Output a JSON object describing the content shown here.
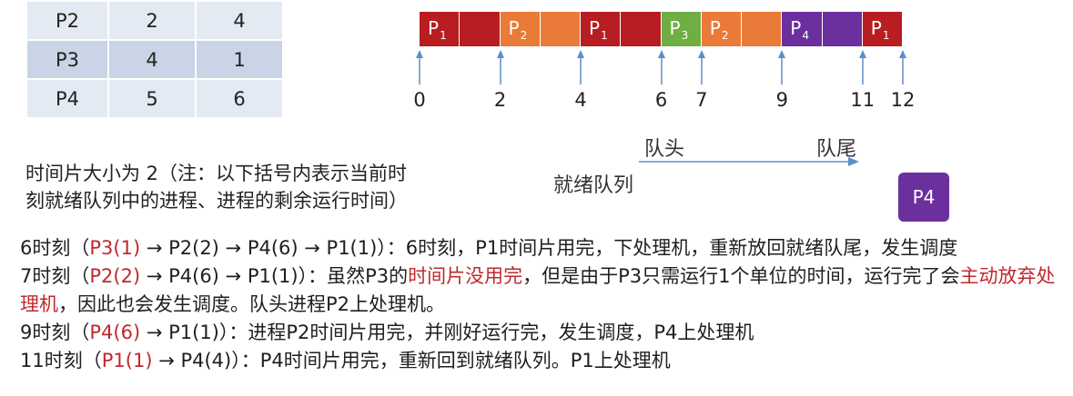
{
  "table": {
    "rows": [
      [
        "P2",
        "2",
        "4"
      ],
      [
        "P3",
        "4",
        "1"
      ],
      [
        "P4",
        "5",
        "6"
      ]
    ]
  },
  "gantt": {
    "segments": [
      {
        "label": "P",
        "sub": "1",
        "color": "#b81d22"
      },
      {
        "label": "",
        "sub": "",
        "color": "#b81d22"
      },
      {
        "label": "P",
        "sub": "2",
        "color": "#ea7a37"
      },
      {
        "label": "",
        "sub": "",
        "color": "#ea7a37"
      },
      {
        "label": "P",
        "sub": "1",
        "color": "#b81d22"
      },
      {
        "label": "",
        "sub": "",
        "color": "#b81d22"
      },
      {
        "label": "P",
        "sub": "3",
        "color": "#6fae43"
      },
      {
        "label": "P",
        "sub": "2",
        "color": "#ea7a37"
      },
      {
        "label": "",
        "sub": "",
        "color": "#ea7a37"
      },
      {
        "label": "P",
        "sub": "4",
        "color": "#6c2f9e"
      },
      {
        "label": "",
        "sub": "",
        "color": "#6c2f9e"
      },
      {
        "label": "P",
        "sub": "1",
        "color": "#b81d22"
      }
    ],
    "times": [
      "0",
      "2",
      "4",
      "6",
      "7",
      "9",
      "11",
      "12"
    ]
  },
  "queue": {
    "head": "队头",
    "tail": "队尾",
    "label": "就绪队列",
    "item": "P4"
  },
  "note": {
    "line1": "时间片大小为 2（注：以下括号内表示当前时",
    "line2": "刻就绪队列中的进程、进程的剩余运行时间）"
  },
  "lines": {
    "l1a": "6时刻（",
    "l1b": "P3(1)",
    "l1c": " → P2(2) → P4(6) → P1(1)）：6时刻，P1时间片用完，下处理机，重新放回就绪队尾，发生调度",
    "l2a": "7时刻（",
    "l2b": "P2(2)",
    "l2c": " → P4(6) → P1(1)）：虽然P3的",
    "l2d": "时间片没用完",
    "l2e": "，但是由于P3只需运行1个单位的时间，运行完了会",
    "l2f": "主动放弃处理机",
    "l2g": "，因此也会发生调度。队头进程P2上处理机。",
    "l3a": "9时刻（",
    "l3b": "P4(6)",
    "l3c": " → P1(1)）：进程P2时间片用完，并刚好运行完，发生调度，P4上处理机",
    "l4a": "11时刻（",
    "l4b": "P1(1)",
    "l4c": " → P4(4)）：P4时间片用完，重新回到就绪队列。P1上处理机"
  },
  "colors": {
    "accent_red": "#c0282d",
    "arrow_blue": "#5b8fc9"
  }
}
